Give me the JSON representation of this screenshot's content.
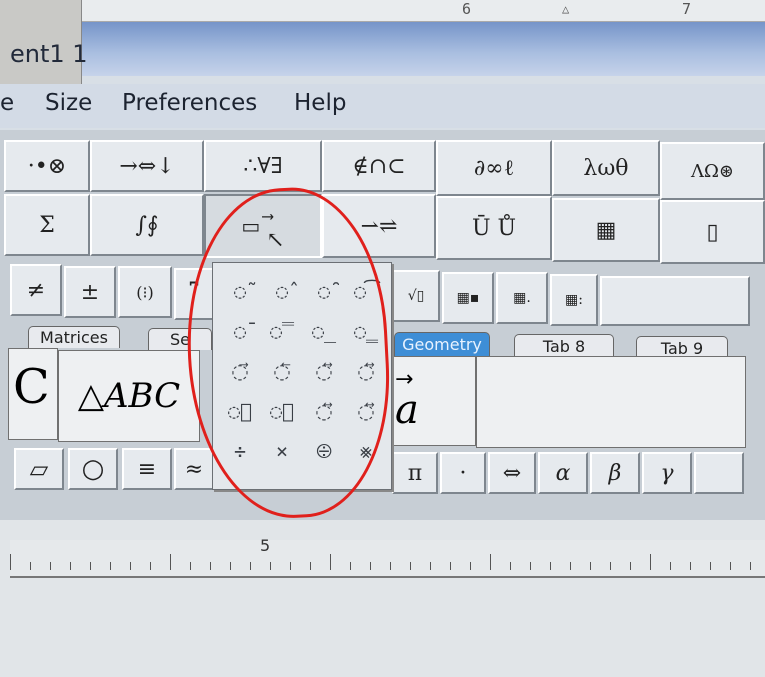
{
  "window": {
    "title": "ent1 1"
  },
  "menu": [
    "e",
    "Size",
    "Preferences",
    "Help"
  ],
  "top_ruler_marks": [
    "6",
    "7"
  ],
  "palette_row1": [
    "·•⊗",
    "→⇔↓",
    "∴∀∃",
    "∉∩⊂",
    "∂∞ℓ",
    "λωθ",
    "ΛΩ⊛"
  ],
  "palette_row2": [
    "Σ",
    "∫∮",
    "⃗",
    "⇀⇌",
    "Ū Ů",
    "▦",
    "▯"
  ],
  "palette_row3": [
    "≠",
    "±",
    "(⁝)",
    "⎴"
  ],
  "tabs": {
    "matrices": "Matrices",
    "sets": "Se",
    "geometry": "Geometry",
    "tab8": "Tab 8",
    "tab9": "Tab 9"
  },
  "templates": {
    "arc": "C",
    "triangle_abc": "△ABC",
    "vector_a": "a"
  },
  "bottom_row": [
    "▱",
    "○",
    "≡",
    "≈",
    "π",
    "·",
    "⇔",
    "α",
    "β",
    "γ"
  ],
  "dropdown_cells": [
    "◌̃",
    "◌̂",
    "◌̑",
    "◌͡",
    "◌̄",
    "◌̿",
    "◌̲",
    "◌̳",
    "◌⃗",
    "◌⃖",
    "◌⃡",
    "◌⃡",
    "◌⃪",
    "◌⃪",
    "◌⃡",
    "◌⃡",
    "÷",
    "⨯",
    "⨸",
    "⨳"
  ],
  "ruler_label": "5",
  "annotation_color": "#e0201c"
}
